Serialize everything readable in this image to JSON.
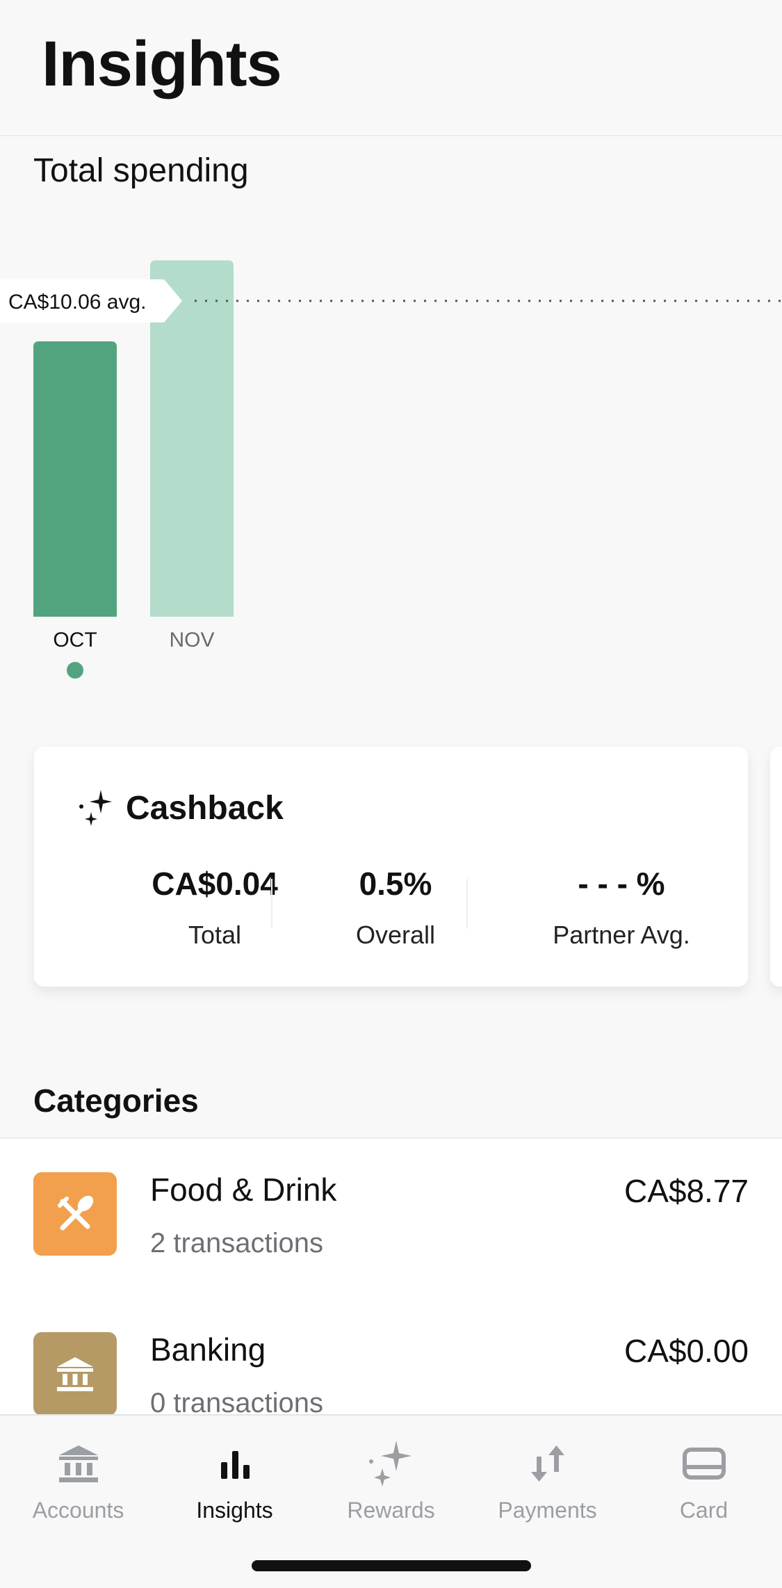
{
  "header": {
    "title": "Insights"
  },
  "spending": {
    "title": "Total spending"
  },
  "chart_data": {
    "type": "bar",
    "categories": [
      "OCT",
      "NOV"
    ],
    "values": [
      8.77,
      11.35
    ],
    "selected_category": "OCT",
    "average_label": "CA$10.06 avg.",
    "average_value": 10.06,
    "ylim": [
      0,
      13
    ],
    "colors": {
      "selected": "#52a47f",
      "unselected": "#b3dccb",
      "selected_dot": "#52a47f"
    }
  },
  "cashback": {
    "title": "Cashback",
    "total_value": "CA$0.04",
    "total_label": "Total",
    "overall_value": "0.5%",
    "overall_label": "Overall",
    "partner_value": "- - - %",
    "partner_label": "Partner Avg."
  },
  "categories": {
    "heading": "Categories",
    "items": [
      {
        "name": "Food & Drink",
        "count": "2 transactions",
        "amount": "CA$8.77",
        "color": "#f2a04d",
        "icon": "utensils-icon"
      },
      {
        "name": "Banking",
        "count": "0 transactions",
        "amount": "CA$0.00",
        "color": "#b59a66",
        "icon": "bank-icon"
      }
    ]
  },
  "nav": {
    "items": [
      {
        "label": "Accounts",
        "icon": "bank-icon",
        "active": false
      },
      {
        "label": "Insights",
        "icon": "bar-chart-icon",
        "active": true
      },
      {
        "label": "Rewards",
        "icon": "sparkle-icon",
        "active": false
      },
      {
        "label": "Payments",
        "icon": "transfer-arrows-icon",
        "active": false
      },
      {
        "label": "Card",
        "icon": "card-icon",
        "active": false
      }
    ]
  }
}
